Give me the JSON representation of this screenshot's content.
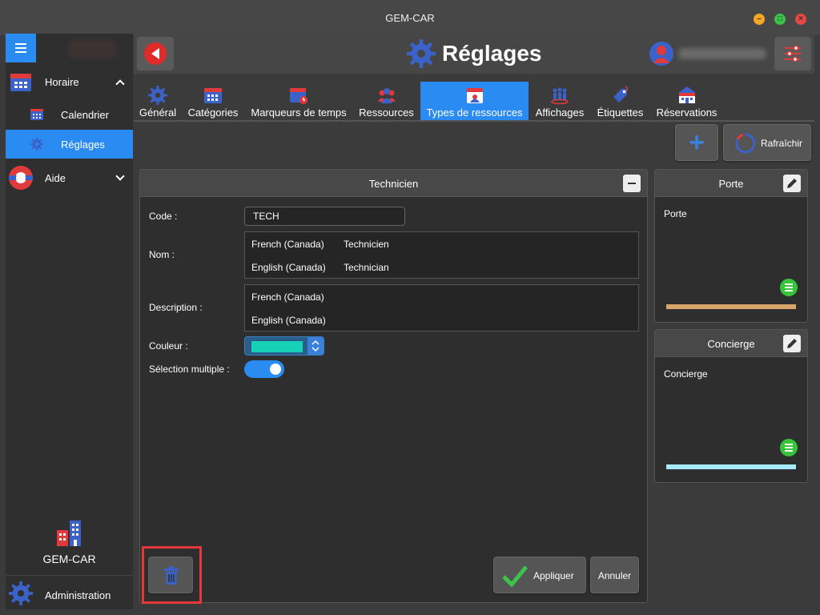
{
  "app": {
    "title": "GEM-CAR",
    "window_buttons": {
      "minimize": "–",
      "maximize": "□",
      "close": "×"
    }
  },
  "sidebar": {
    "items": [
      {
        "label": "Horaire",
        "icon": "calendar-icon"
      },
      {
        "label": "Calendrier",
        "icon": "calendar-grid-icon"
      },
      {
        "label": "Réglages",
        "icon": "gear-icon"
      },
      {
        "label": "Aide",
        "icon": "lifebuoy-icon"
      }
    ],
    "brand": "GEM-CAR",
    "admin": "Administration"
  },
  "header": {
    "title": "Réglages"
  },
  "tabs": [
    {
      "label": "Général",
      "icon": "gear-icon"
    },
    {
      "label": "Catégories",
      "icon": "calendar-grid-icon"
    },
    {
      "label": "Marqueurs de temps",
      "icon": "calendar-clock-icon"
    },
    {
      "label": "Ressources",
      "icon": "people-icon"
    },
    {
      "label": "Types de ressources",
      "icon": "id-card-icon"
    },
    {
      "label": "Affichages",
      "icon": "group-icon"
    },
    {
      "label": "Étiquettes",
      "icon": "tag-icon"
    },
    {
      "label": "Réservations",
      "icon": "building-icon"
    }
  ],
  "actions": {
    "add": "+",
    "refresh": "Rafraîchir"
  },
  "panel": {
    "title": "Technicien",
    "code_label": "Code :",
    "code_value": "TECH",
    "name_label": "Nom :",
    "names": [
      {
        "lang": "French (Canada)",
        "value": "Technicien"
      },
      {
        "lang": "English (Canada)",
        "value": "Technician"
      }
    ],
    "description_label": "Description :",
    "descriptions": [
      {
        "lang": "French (Canada)",
        "value": ""
      },
      {
        "lang": "English (Canada)",
        "value": ""
      }
    ],
    "color_label": "Couleur :",
    "color_value": "#17d1b6",
    "multiple_label": "Sélection multiple :",
    "multiple_value": true,
    "apply": "Appliquer",
    "cancel": "Annuler"
  },
  "cards": [
    {
      "title": "Porte",
      "body": "Porte",
      "color": "#d8a66b"
    },
    {
      "title": "Concierge",
      "body": "Concierge",
      "color": "#a6e9f7"
    }
  ]
}
